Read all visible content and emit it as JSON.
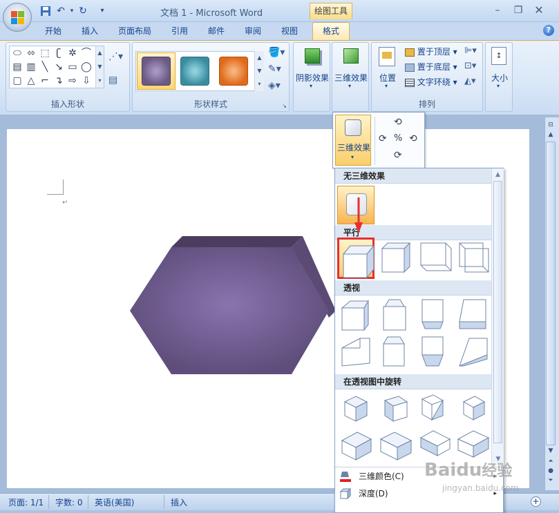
{
  "window": {
    "title": "文档 1 - Microsoft Word",
    "context_tab_group": "绘图工具",
    "controls": [
      "minimize",
      "restore",
      "close"
    ]
  },
  "tabs": [
    "开始",
    "插入",
    "页面布局",
    "引用",
    "邮件",
    "审阅",
    "视图"
  ],
  "active_tab": "格式",
  "ribbon": {
    "insert_shapes_label": "插入形状",
    "shape_styles_label": "形状样式",
    "shadow_effects_label": "阴影效果",
    "threed_effects_label": "三维效果",
    "arrange_label": "排列",
    "position_label": "位置",
    "bring_to_front": "置于顶层",
    "send_to_back": "置于底层",
    "text_wrapping": "文字环绕",
    "size_label": "大小",
    "style_colors": [
      "#6b5a86",
      "#3a8da0",
      "#e06a1c"
    ]
  },
  "dropdown": {
    "threed_button_label": "三维效果",
    "sections": {
      "none": "无三维效果",
      "parallel": "平行",
      "perspective": "透视",
      "rotate_perspective": "在透视图中旋转"
    },
    "menu": {
      "color": "三维颜色(C)",
      "depth": "深度(D)"
    }
  },
  "document": {
    "shape_color": "#6b5a86",
    "paragraph_mark": "↵"
  },
  "status": {
    "page": "页面: 1/1",
    "words": "字数: 0",
    "language": "英语(美国)",
    "mode": "插入"
  },
  "watermark": {
    "brand": "Baidu",
    "text": "经验",
    "url": "jingyan.baidu.com"
  }
}
